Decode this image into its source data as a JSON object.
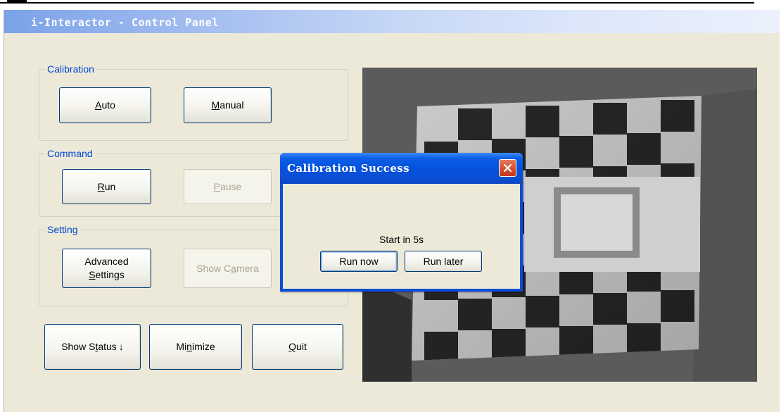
{
  "window": {
    "title": "i-Interactor - Control Panel"
  },
  "calibration": {
    "legend": "Calibration",
    "auto_label": "Auto",
    "manual_label": "Manual"
  },
  "command": {
    "legend": "Command",
    "run_label": "Run",
    "pause_label": "Pause"
  },
  "setting": {
    "legend": "Setting",
    "advanced_label_line1": "Advanced",
    "advanced_label_line2": "Settings",
    "show_camera_label": "Show Camera"
  },
  "footer": {
    "show_status_label": "Show Status",
    "show_status_arrow": "↓",
    "minimize_label": "Minimize",
    "quit_label": "Quit"
  },
  "dialog": {
    "title": "Calibration Success",
    "message": "Start in 5s",
    "run_now_label": "Run now",
    "run_later_label": "Run later"
  },
  "colors": {
    "window_bg": "#ece9d8",
    "group_legend": "#0046d5",
    "dialog_frame": "#0a4cd8",
    "close_button": "#d64b2a"
  },
  "icons": {
    "close": "close-icon"
  }
}
